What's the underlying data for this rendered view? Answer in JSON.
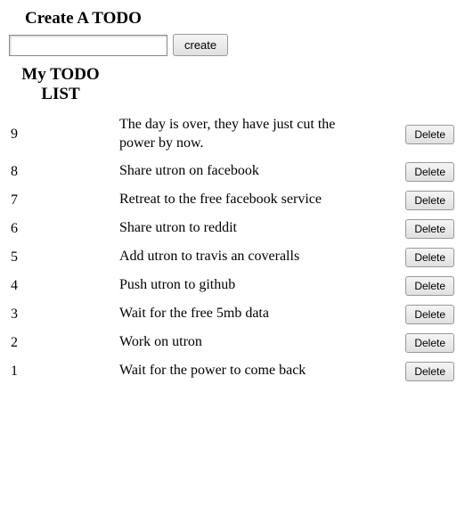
{
  "form": {
    "heading": "Create A TODO",
    "input_value": "",
    "submit_label": "create"
  },
  "table": {
    "heading": "My TODO LIST",
    "delete_label": "Delete",
    "rows": [
      {
        "id": "9",
        "body": "The day is over, they have just cut the power by now."
      },
      {
        "id": "8",
        "body": "Share utron on facebook"
      },
      {
        "id": "7",
        "body": "Retreat to the free facebook service"
      },
      {
        "id": "6",
        "body": "Share utron to reddit"
      },
      {
        "id": "5",
        "body": "Add utron to travis an coveralls"
      },
      {
        "id": "4",
        "body": "Push utron to github"
      },
      {
        "id": "3",
        "body": "Wait for the free 5mb data"
      },
      {
        "id": "2",
        "body": "Work on utron"
      },
      {
        "id": "1",
        "body": "Wait for the power to come back"
      }
    ]
  }
}
